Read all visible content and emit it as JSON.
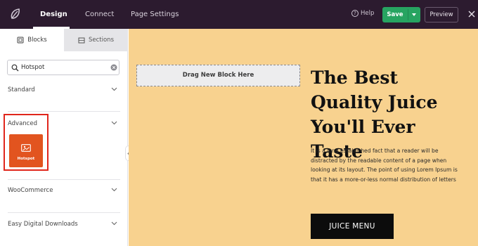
{
  "topbar": {
    "tabs": [
      {
        "label": "Design",
        "active": true
      },
      {
        "label": "Connect",
        "active": false
      },
      {
        "label": "Page Settings",
        "active": false
      }
    ],
    "help_label": "Help",
    "save_label": "Save",
    "preview_label": "Preview",
    "colors": {
      "bar": "#2c1b2f",
      "save": "#27a461"
    }
  },
  "sidebar": {
    "tabs": [
      {
        "label": "Blocks",
        "icon": "blocks-icon",
        "active": true
      },
      {
        "label": "Sections",
        "icon": "sections-icon",
        "active": false
      }
    ],
    "search": {
      "value": "Hotspot",
      "placeholder": "Search blocks"
    },
    "categories": [
      {
        "label": "Standard",
        "expanded": false
      },
      {
        "label": "Advanced",
        "expanded": true,
        "highlighted": true
      },
      {
        "label": "WooCommerce",
        "expanded": false
      },
      {
        "label": "Easy Digital Downloads",
        "expanded": false
      }
    ],
    "advanced_blocks": [
      {
        "label": "Hotspot",
        "icon": "image-icon",
        "color": "#e2541f"
      }
    ]
  },
  "canvas": {
    "background": "#f8d28f",
    "drop_zone_label": "Drag New Block Here",
    "headline": "The Best Quality Juice You'll Ever Taste",
    "body": "It is a long established fact that a reader will be distracted by the readable content of a page when looking at its layout. The point of using Lorem Ipsum is that it has a more-or-less normal distribution of letters",
    "cta_label": "JUICE MENU"
  }
}
